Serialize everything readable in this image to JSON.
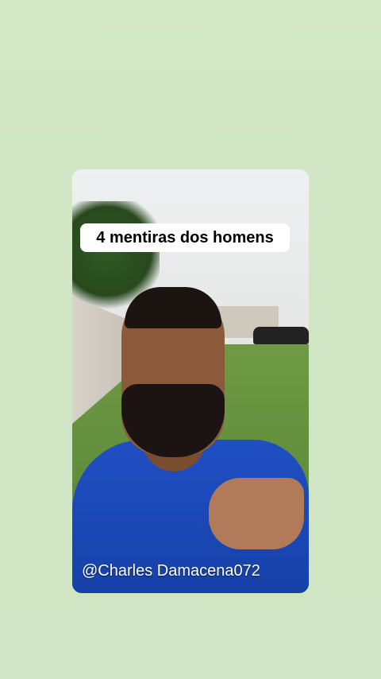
{
  "story": {
    "title_caption": "4 mentiras dos homens",
    "watermark": "@Charles Damacena072"
  },
  "colors": {
    "background": "#d3e7c6",
    "caption_bg": "#ffffff",
    "shirt": "#1f4fc4"
  }
}
